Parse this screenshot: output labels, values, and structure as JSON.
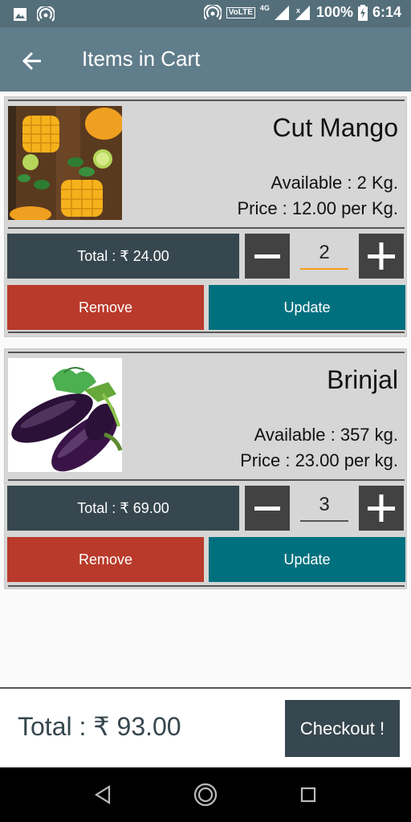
{
  "status_bar": {
    "battery": "100%",
    "time": "6:14",
    "volte": "VoLTE",
    "network": "4G"
  },
  "app_bar": {
    "title": "Items in Cart"
  },
  "cart_items": [
    {
      "name": "Cut Mango",
      "available": "Available : 2 Kg.",
      "price": "Price : 12.00 per Kg.",
      "total": "Total : ₹ 24.00",
      "quantity": "2",
      "remove_label": "Remove",
      "update_label": "Update"
    },
    {
      "name": "Brinjal",
      "available": "Available : 357 kg.",
      "price": "Price : 23.00 per kg.",
      "total": "Total : ₹ 69.00",
      "quantity": "3",
      "remove_label": "Remove",
      "update_label": "Update"
    }
  ],
  "footer": {
    "grand_total": "Total : ₹ 93.00",
    "checkout_label": "Checkout !"
  },
  "colors": {
    "app_bar": "#607d8b",
    "status_bar": "#546e7a",
    "remove": "#b93a2a",
    "update": "#00707f",
    "dark": "#37474f",
    "active_underline": "#f59e1b"
  },
  "icons": {
    "back": "arrow-left-icon",
    "minus": "minus-icon",
    "plus": "plus-icon",
    "nav_back": "triangle-back-icon",
    "nav_home": "circle-home-icon",
    "nav_recents": "square-recents-icon"
  }
}
